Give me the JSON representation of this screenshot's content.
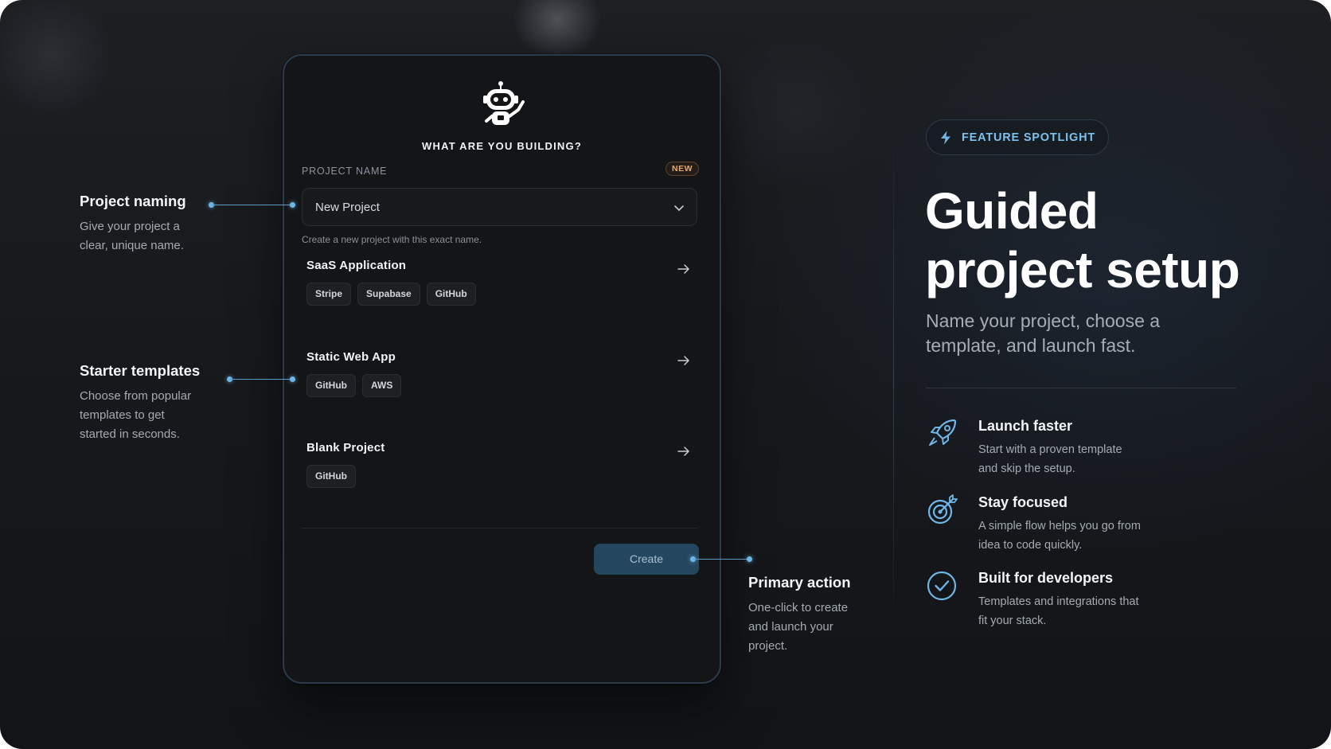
{
  "colors": {
    "accent": "#6fb6e6",
    "badge": "#e9a56a",
    "button": "#24465e",
    "background": "#17191d"
  },
  "card": {
    "title": "WHAT ARE YOU BUILDING?",
    "mascot_icon": "robot-mascot-icon",
    "field_label": "PROJECT NAME",
    "badge": "NEW",
    "select_value": "New Project",
    "helper": "Create a new project with this exact name.",
    "templates": [
      {
        "name": "SaaS Application",
        "chips": [
          "Stripe",
          "Supabase",
          "GitHub"
        ]
      },
      {
        "name": "Static Web App",
        "chips": [
          "GitHub",
          "AWS"
        ]
      },
      {
        "name": "Blank Project",
        "chips": [
          "GitHub"
        ]
      }
    ],
    "create_label": "Create"
  },
  "callouts": {
    "naming": {
      "title": "Project naming",
      "lines": [
        "Give your project a",
        "clear, unique name."
      ]
    },
    "templates": {
      "title": "Starter templates",
      "lines": [
        "Choose from popular",
        "templates to get",
        "started in seconds."
      ]
    },
    "primary": {
      "title": "Primary action",
      "lines": [
        "One-click to create",
        "and launch your",
        "project."
      ]
    }
  },
  "spotlight": {
    "pill_label": "FEATURE SPOTLIGHT",
    "pill_icon": "lightning-icon",
    "title_line1": "Guided",
    "title_line2": "project setup",
    "subtitle": "Name your project, choose a template, and launch fast.",
    "features": [
      {
        "icon": "rocket-icon",
        "title": "Launch faster",
        "lines": [
          "Start with a proven template",
          "and skip the setup."
        ]
      },
      {
        "icon": "target-icon",
        "title": "Stay focused",
        "lines": [
          "A simple flow helps you go from",
          "idea to code quickly."
        ]
      },
      {
        "icon": "check-circle-icon",
        "title": "Built for developers",
        "lines": [
          "Templates and integrations that",
          "fit your stack."
        ]
      }
    ]
  }
}
